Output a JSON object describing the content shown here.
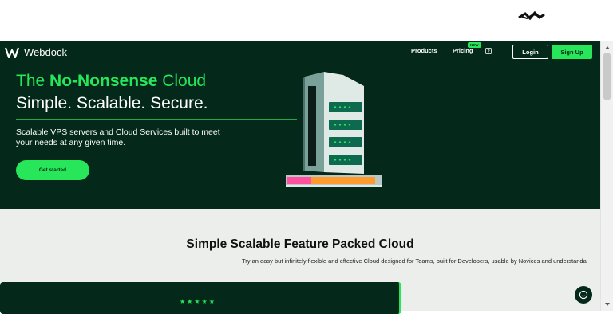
{
  "browser": {
    "scribble_icon": "redacted-scribble"
  },
  "nav": {
    "brand": "Webdock",
    "logo_icon": "webdock-w-logo",
    "products": "Products",
    "pricing": "Pricing",
    "pricing_badge": "NEW",
    "help_icon": "help-square-icon",
    "login": "Login",
    "signup": "Sign Up"
  },
  "hero": {
    "title_prefix": "The ",
    "title_emphasis": "No-Nonsense",
    "title_suffix": " Cloud",
    "subtitle": "Simple. Scalable. Secure.",
    "description": "Scalable VPS servers and Cloud Services built to meet your needs at any given time.",
    "cta": "Get started",
    "illustration": "server-tower-illustration"
  },
  "features": {
    "title": "Simple Scalable Feature Packed Cloud",
    "subtitle": "Try an easy but infinitely flexible and effective Cloud designed for Teams, built for Developers, usable by Novices and understanda",
    "rating_stars": "★★★★★"
  },
  "widgets": {
    "chat_icon": "chat-bubble-icon"
  },
  "colors": {
    "accent": "#27e65a",
    "hero_bg": "#04291a",
    "section_bg": "#ebeeea"
  }
}
